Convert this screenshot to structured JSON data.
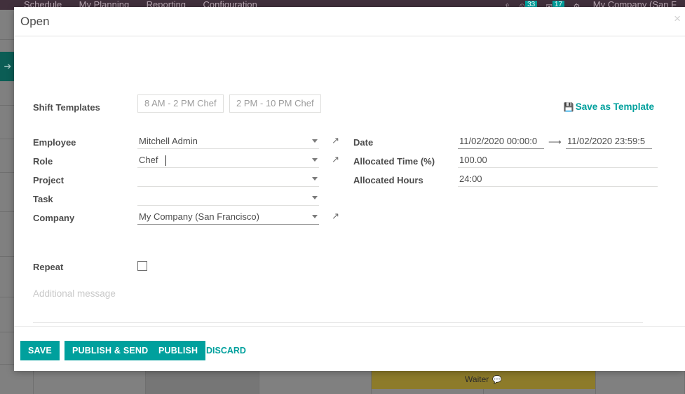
{
  "navbar": {
    "items": [
      {
        "label": "Schedule"
      },
      {
        "label": "My Planning"
      },
      {
        "label": "Reporting"
      },
      {
        "label": "Configuration"
      }
    ],
    "right": {
      "upload_icon": "upload-icon",
      "activity_icon": "clock-icon",
      "activity_count": "33",
      "messages_icon": "message-icon",
      "messages_count": "17",
      "settings_icon": "gear-icon",
      "company": "My Company (San F"
    }
  },
  "background": {
    "expand_icon": "arrow-right-icon",
    "shift_bar": {
      "label": "Waiter",
      "comment_icon": "comment-bubble-icon"
    }
  },
  "modal": {
    "title": "Open",
    "close_icon": "close-icon",
    "shift_templates": {
      "label": "Shift Templates",
      "options": [
        "8 AM - 2 PM Chef",
        "2 PM - 10 PM Chef"
      ],
      "save_as_template": "Save as Template",
      "save_icon": "floppy-save-icon"
    },
    "fields_left": [
      {
        "label": "Employee",
        "value": "Mitchell Admin",
        "placeholder": "",
        "has_dropdown": true,
        "has_external_link": true,
        "focused": false,
        "strong_underline": false
      },
      {
        "label": "Role",
        "value": "Chef",
        "placeholder": "",
        "has_dropdown": true,
        "has_external_link": true,
        "focused": true,
        "strong_underline": false
      },
      {
        "label": "Project",
        "value": "",
        "placeholder": "",
        "has_dropdown": true,
        "has_external_link": false,
        "focused": false,
        "strong_underline": false
      },
      {
        "label": "Task",
        "value": "",
        "placeholder": "",
        "has_dropdown": true,
        "has_external_link": false,
        "focused": false,
        "strong_underline": false
      },
      {
        "label": "Company",
        "value": "My Company (San Francisco)",
        "placeholder": "",
        "has_dropdown": true,
        "has_external_link": true,
        "focused": false,
        "strong_underline": true
      }
    ],
    "fields_right": {
      "date": {
        "label": "Date",
        "start": "11/02/2020 00:00:0",
        "end": "11/02/2020 23:59:5",
        "arrow_icon": "arrow-right-icon"
      },
      "allocated_time": {
        "label": "Allocated Time (%)",
        "value": "100.00"
      },
      "allocated_hours": {
        "label": "Allocated Hours",
        "value": "24:00"
      }
    },
    "repeat": {
      "label": "Repeat",
      "checked": false
    },
    "message": {
      "placeholder": "Additional message",
      "value": ""
    },
    "footer": {
      "save": "SAVE",
      "publish_send": "PUBLISH & SEND",
      "publish": "PUBLISH",
      "discard": "DISCARD"
    }
  },
  "colors": {
    "accent_teal": "#00A09D",
    "navbar_purple": "#41303C",
    "shift_bar_olive": "#8D7B2A"
  }
}
